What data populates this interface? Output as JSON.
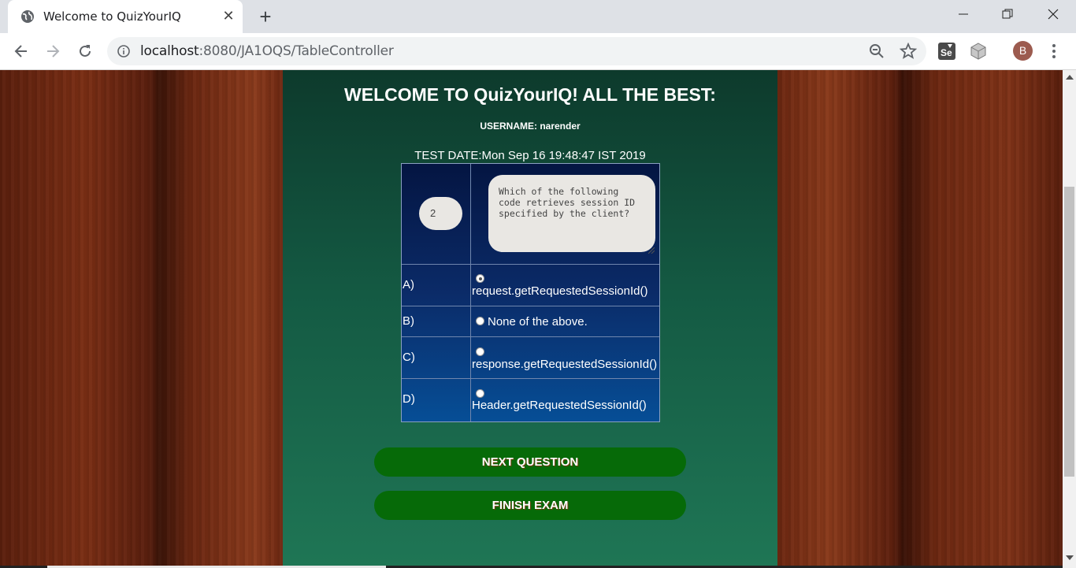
{
  "browser": {
    "tab_title": "Welcome to QuizYourIQ",
    "url_host": "localhost",
    "url_rest": ":8080/JA1OQS/TableController",
    "profile_initial": "B",
    "extension_se_label": "Se"
  },
  "page": {
    "welcome": "WELCOME TO QuizYourIQ! ALL THE BEST:",
    "username_line": "USERNAME: narender",
    "test_date_line": "TEST DATE:Mon Sep 16 19:48:47 IST 2019",
    "question_number": "2",
    "question_text": "Which of the following code retrieves session ID specified by the client?",
    "options": [
      {
        "label": "A)",
        "text": "request.getRequestedSessionId()",
        "selected": true
      },
      {
        "label": "B)",
        "text": "None of the above.",
        "selected": false
      },
      {
        "label": "C)",
        "text": "response.getRequestedSessionId()",
        "selected": false
      },
      {
        "label": "D)",
        "text": "Header.getRequestedSessionId()",
        "selected": false
      }
    ],
    "next_button": "NEXT QUESTION",
    "finish_button": "FINISH EXAM"
  },
  "colors": {
    "button_green": "#066a08",
    "panel_green": "#145a43",
    "table_blue": "#0b2b68"
  }
}
